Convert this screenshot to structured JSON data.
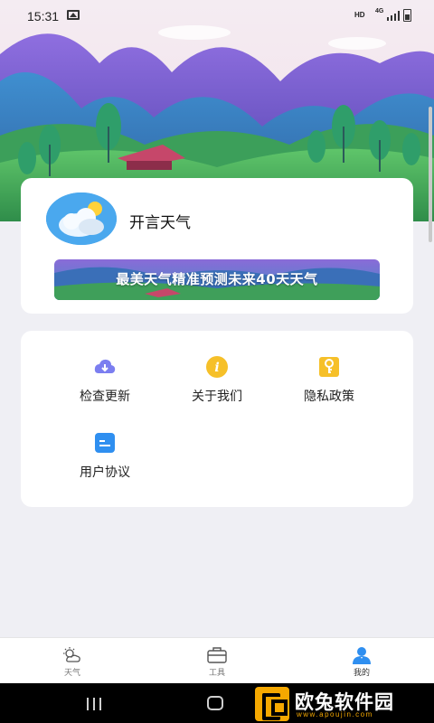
{
  "status_bar": {
    "time": "15:31",
    "hd": "HD",
    "network": "4G"
  },
  "profile": {
    "app_name": "开言天气",
    "banner_text": "最美天气精准预测未来40天天气"
  },
  "menu": {
    "items": [
      {
        "label": "检查更新",
        "icon": "cloud-download-icon",
        "color": "#7b7ef0"
      },
      {
        "label": "关于我们",
        "icon": "info-icon",
        "color": "#f6c029"
      },
      {
        "label": "隐私政策",
        "icon": "key-icon",
        "color": "#f6c029"
      },
      {
        "label": "用户协议",
        "icon": "document-icon",
        "color": "#2f8ff0"
      }
    ]
  },
  "tabbar": {
    "tabs": [
      {
        "label": "天气",
        "icon": "weather-icon",
        "active": false
      },
      {
        "label": "工具",
        "icon": "toolbox-icon",
        "active": false
      },
      {
        "label": "我的",
        "icon": "user-icon",
        "active": true
      }
    ],
    "active_color": "#2f8ff0"
  },
  "watermark": {
    "title": "欧兔软件园",
    "url": "www.apoujin.com"
  }
}
